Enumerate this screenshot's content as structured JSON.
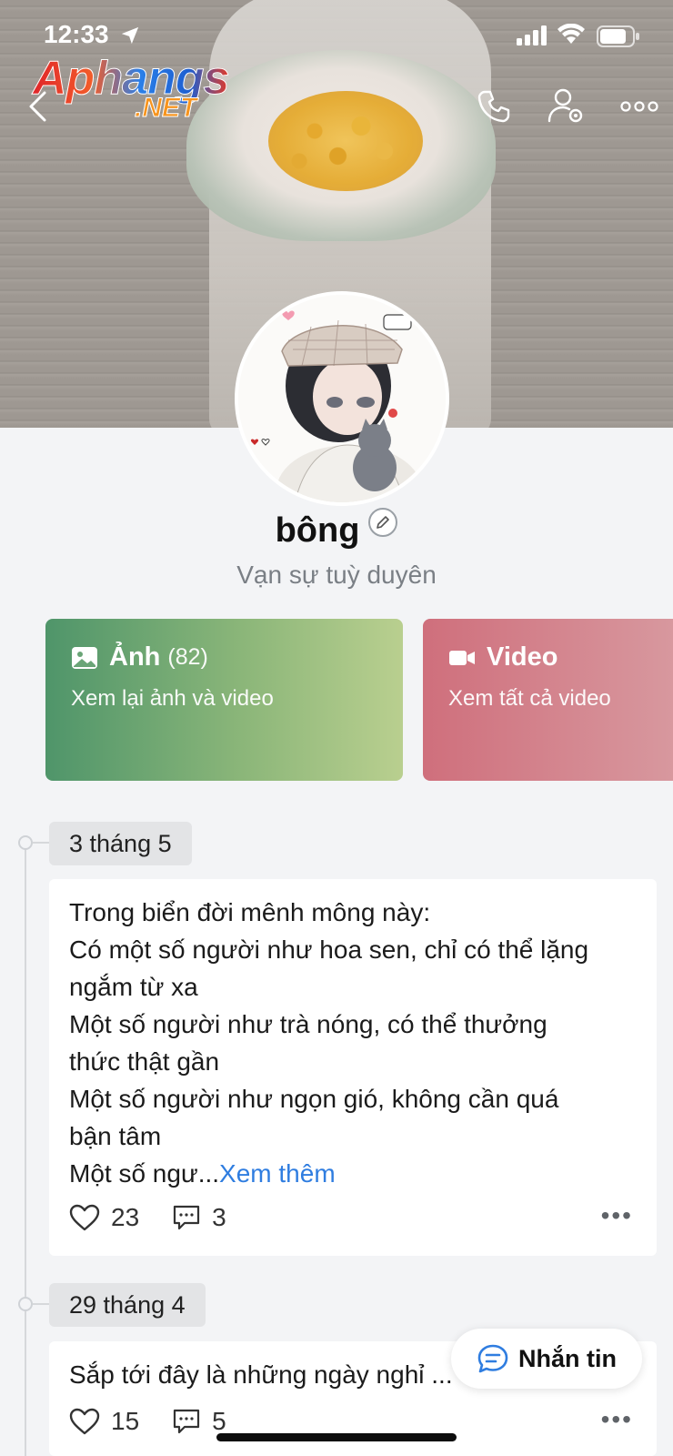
{
  "status_bar": {
    "time": "12:33",
    "icons": [
      "location-arrow-icon",
      "cellular-signal-icon",
      "wifi-icon",
      "battery-icon"
    ]
  },
  "watermark": {
    "main": "Aphangs",
    "suffix": ".NET"
  },
  "top_nav": {
    "icons": [
      "back-chevron-icon",
      "phone-icon",
      "user-settings-icon",
      "more-horizontal-icon"
    ]
  },
  "profile": {
    "name": "bông",
    "bio": "Vạn sự tuỳ duyên"
  },
  "media_cards": {
    "photos": {
      "title": "Ảnh",
      "count": "(82)",
      "subtitle": "Xem lại ảnh và video",
      "icon": "image-icon"
    },
    "videos": {
      "title": "Video",
      "subtitle": "Xem tất cả video",
      "icon": "video-camera-icon"
    }
  },
  "timeline": {
    "posts": [
      {
        "date": "3 tháng 5",
        "lines": [
          "Trong biển đời mênh mông này:",
          "Có một số người như hoa sen, chỉ có thể lặng",
          "ngắm từ xa",
          "Một số người như trà nóng, có thể thưởng",
          "thức thật gần",
          "Một số người như ngọn gió, không cần quá",
          "bận tâm",
          "Một số ngư..."
        ],
        "see_more": "Xem thêm",
        "likes": "23",
        "comments": "3"
      },
      {
        "date": "29 tháng 4",
        "lines": [
          "Sắp tới đây là những ngày nghỉ ..."
        ],
        "likes": "15",
        "comments": "5"
      }
    ]
  },
  "message_button": {
    "label": "Nhắn tin",
    "icon": "chat-bubble-icon"
  },
  "colors": {
    "link": "#2f7de0",
    "photos_card_start": "#4f956a",
    "photos_card_end": "#b9cf8f",
    "videos_card_start": "#cf6f7c",
    "videos_card_end": "#d89aa0"
  }
}
